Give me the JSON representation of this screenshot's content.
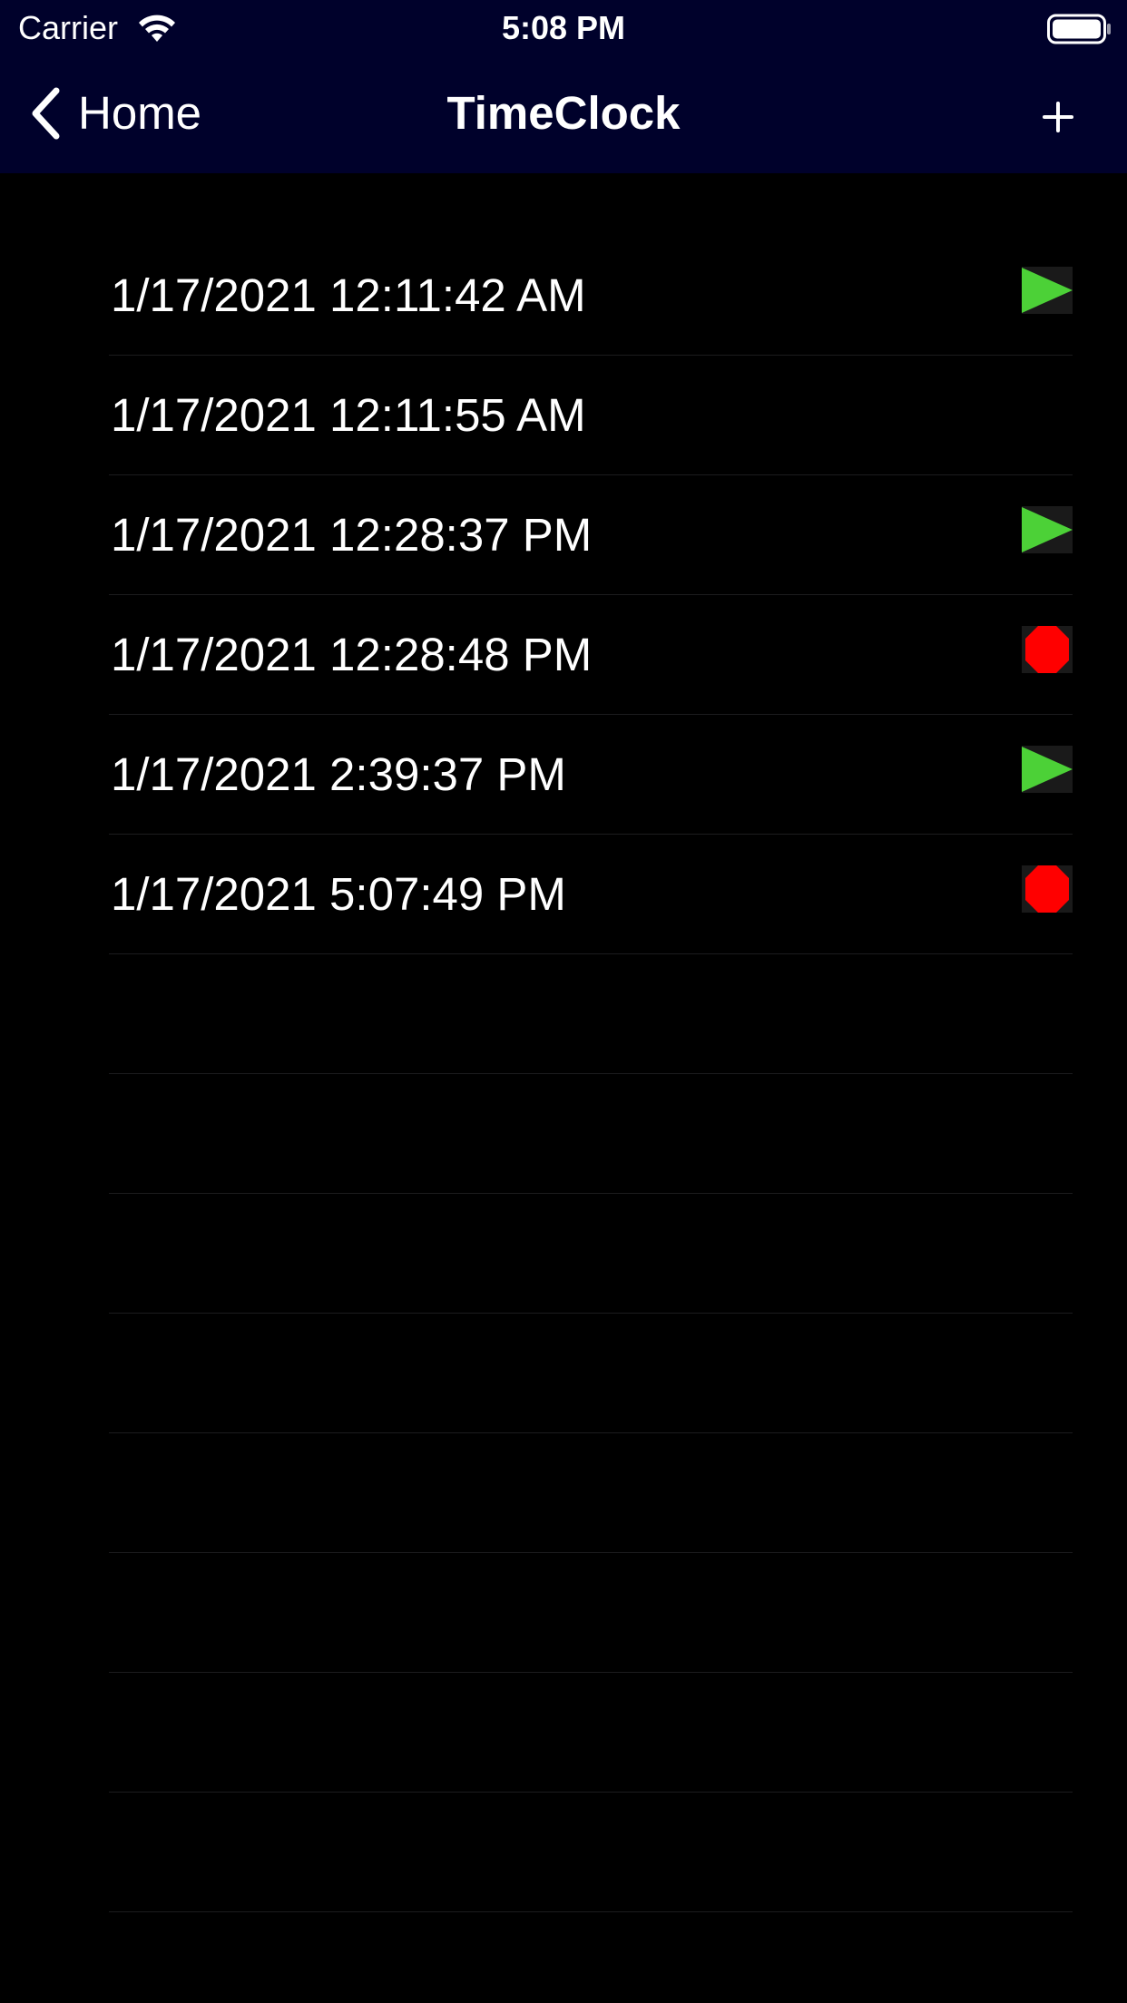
{
  "status_bar": {
    "carrier": "Carrier",
    "time": "5:08 PM",
    "wifi_icon": "wifi-icon",
    "battery_icon": "battery-icon"
  },
  "nav": {
    "back_label": "Home",
    "back_icon": "chevron-left-icon",
    "title": "TimeClock",
    "add_label": "+",
    "background_color": "#00012b"
  },
  "colors": {
    "start": "#4cd137",
    "stop": "#ff0000"
  },
  "entries": [
    {
      "timestamp": "1/17/2021 12:11:42 AM",
      "icon": "play-icon"
    },
    {
      "timestamp": "1/17/2021 12:11:55 AM",
      "icon": ""
    },
    {
      "timestamp": "1/17/2021 12:28:37 PM",
      "icon": "play-icon"
    },
    {
      "timestamp": "1/17/2021 12:28:48 PM",
      "icon": "stop-icon"
    },
    {
      "timestamp": "1/17/2021 2:39:37 PM",
      "icon": "play-icon"
    },
    {
      "timestamp": "1/17/2021 5:07:49 PM",
      "icon": "stop-icon"
    }
  ]
}
